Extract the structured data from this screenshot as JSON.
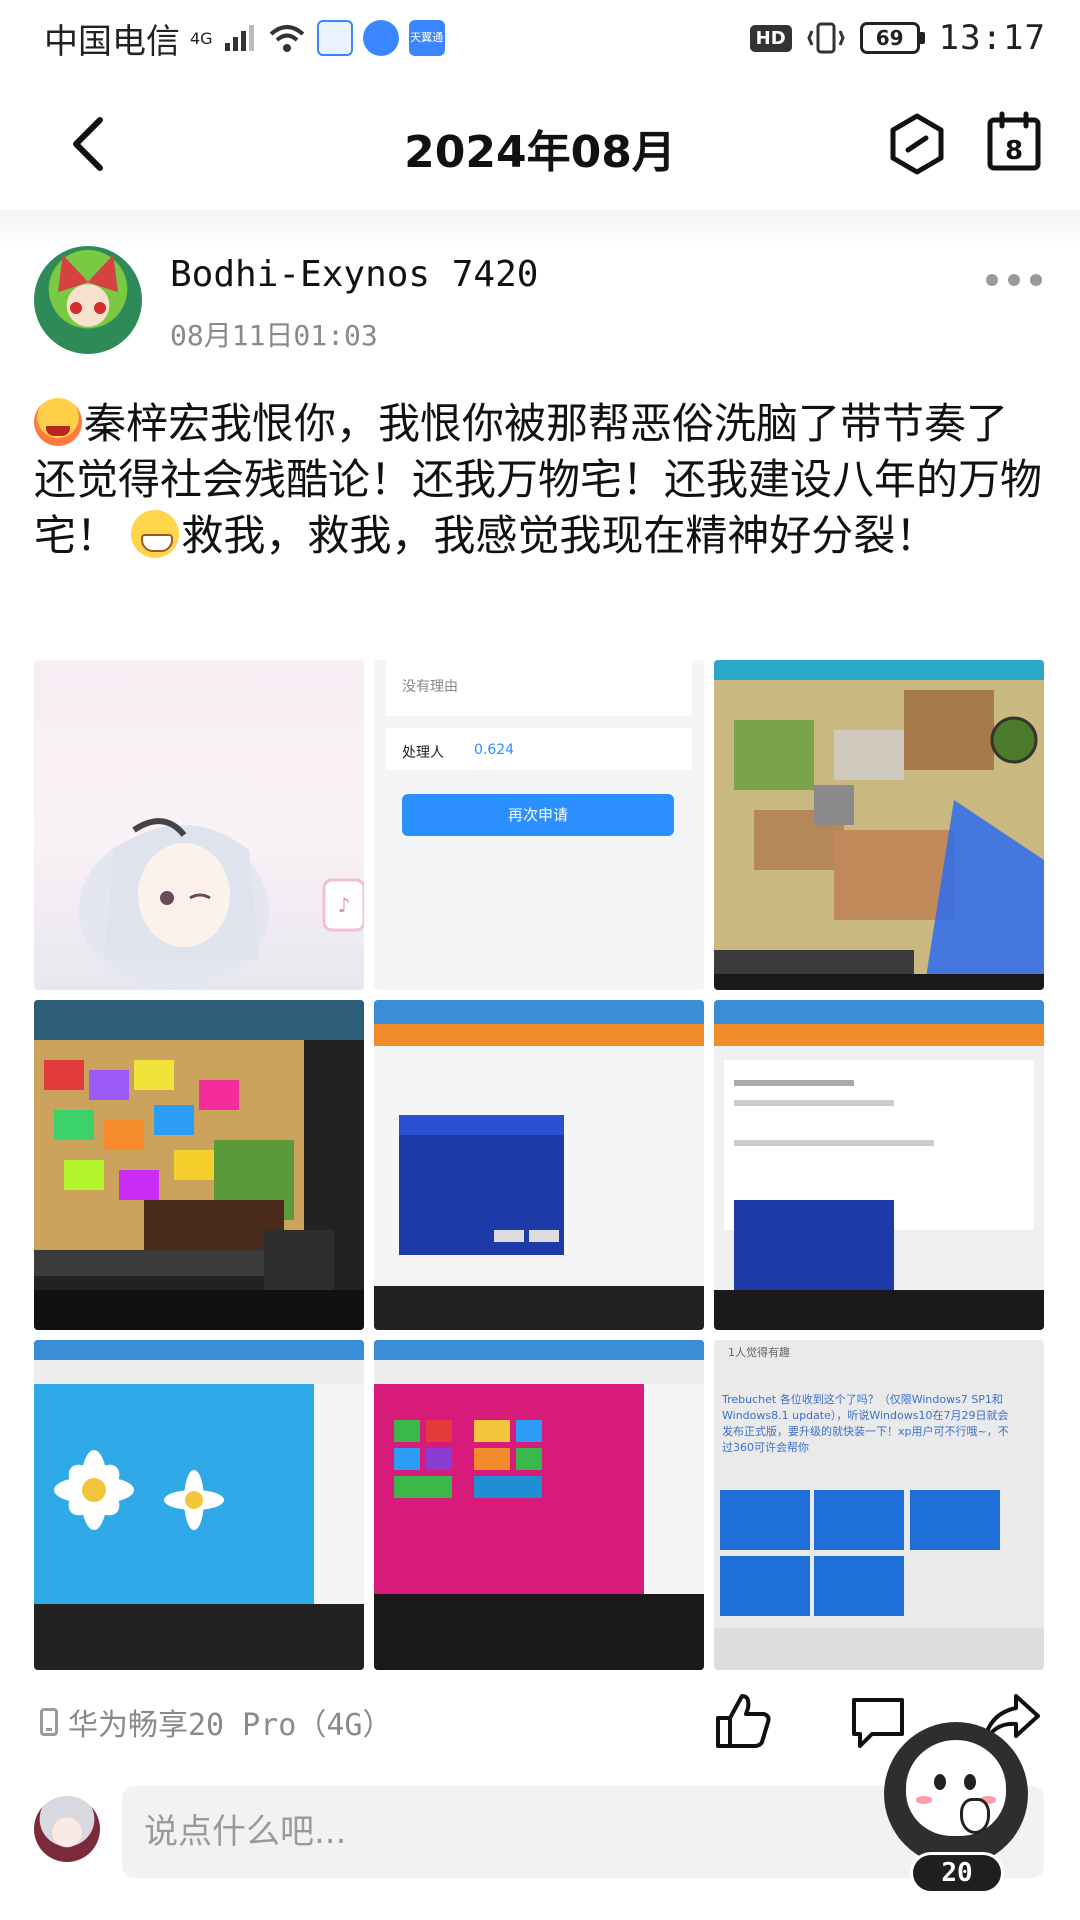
{
  "status_bar": {
    "carrier": "中国电信",
    "network": "4G",
    "app_badge_1": "",
    "app_badge_2": "",
    "app_badge_3": "天翼通",
    "hd_label": "HD",
    "battery": "69",
    "time": "13:17"
  },
  "header": {
    "title": "2024年08月",
    "calendar_day": "8"
  },
  "post": {
    "username": "Bodhi-Exynos 7420",
    "time": "08月11日01:03",
    "text_part1": "秦梓宏我恨你，我恨你被那帮恶俗洗脑了带节奏了还觉得社会残酷论！还我万物宅！还我建设八年的万物宅！",
    "text_part2": "救我，救我，我感觉我现在精神好分裂！",
    "device": "华为畅享20 Pro（4G）"
  },
  "images": {
    "img2_reason": "没有理由",
    "img2_handler_label": "处理人",
    "img2_handler_value": "0.624",
    "img2_button": "再次申请",
    "img9_header": "1人觉得有趣",
    "img9_line": "Trebuchet  各位收到这个了吗？（仅限Windows7 SP1和Windows8.1 update），听说Windows10在7月29日就会发布正式版，要升级的就快装一下！xp用户可不行哦~，不过360可许会帮你"
  },
  "comment_bar": {
    "placeholder": "说点什么吧..."
  },
  "mascot": {
    "badge": "20"
  },
  "colors": {
    "accent_blue": "#2b8fff",
    "windows_blue": "#1e3aa8",
    "magenta": "#d81b7a"
  },
  "icons": [
    "back-arrow-icon",
    "hexagon-icon",
    "calendar-icon",
    "more-dots-icon",
    "phone-icon",
    "thumbs-up-icon",
    "comment-icon",
    "share-icon"
  ]
}
